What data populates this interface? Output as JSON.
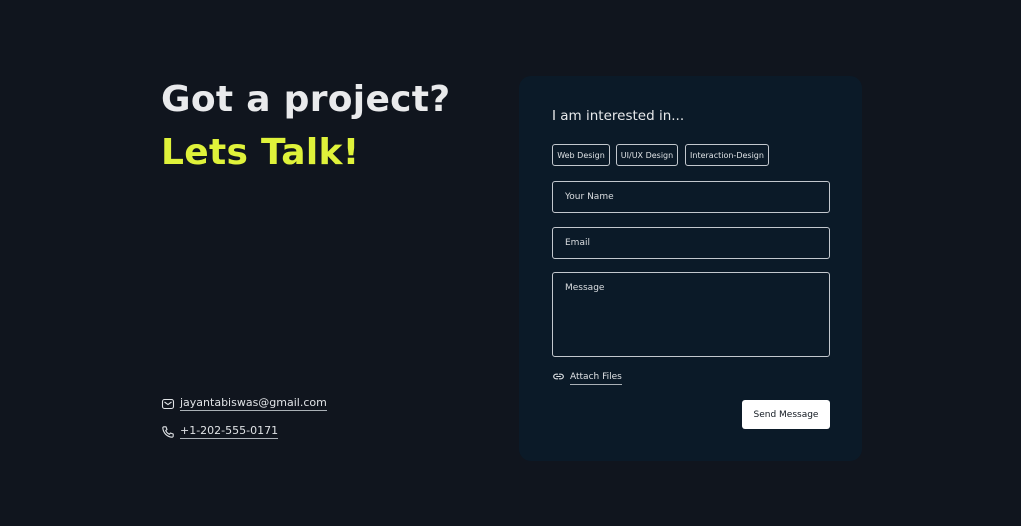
{
  "hero": {
    "line1": "Got a project?",
    "line2": "Lets Talk!"
  },
  "contact": {
    "email": "jayantabiswas@gmail.com",
    "phone": "+1-202-555-0171",
    "email_icon": "mail-icon",
    "phone_icon": "phone-icon"
  },
  "form": {
    "interest_label": "I am interested in...",
    "chips": [
      "Web Design",
      "UI/UX Design",
      "Interaction-Design"
    ],
    "name_placeholder": "Your Name",
    "email_placeholder": "Email",
    "message_placeholder": "Message",
    "attach_label": "Attach Files",
    "attach_icon": "link-icon",
    "send_label": "Send Message"
  },
  "colors": {
    "background": "#10151e",
    "card": "#0b1a28",
    "accent": "#dff23a"
  }
}
